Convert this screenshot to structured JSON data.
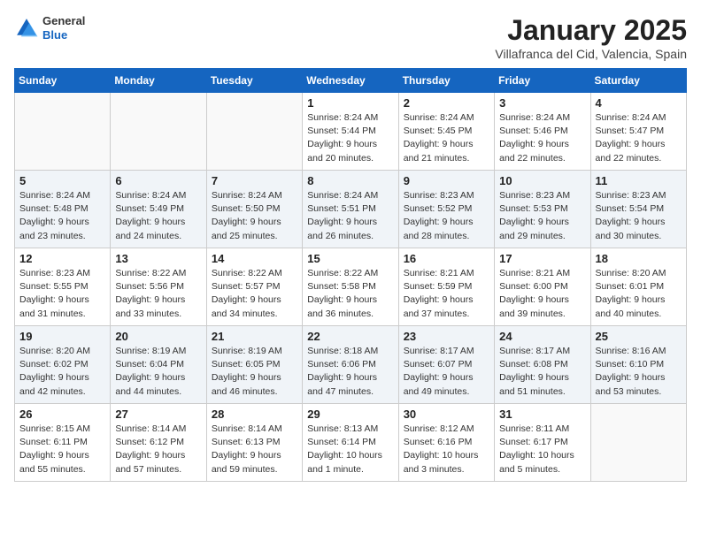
{
  "header": {
    "logo_general": "General",
    "logo_blue": "Blue",
    "month_title": "January 2025",
    "location": "Villafranca del Cid, Valencia, Spain"
  },
  "weekdays": [
    "Sunday",
    "Monday",
    "Tuesday",
    "Wednesday",
    "Thursday",
    "Friday",
    "Saturday"
  ],
  "weeks": [
    [
      {
        "day": "",
        "sunrise": "",
        "sunset": "",
        "daylight": ""
      },
      {
        "day": "",
        "sunrise": "",
        "sunset": "",
        "daylight": ""
      },
      {
        "day": "",
        "sunrise": "",
        "sunset": "",
        "daylight": ""
      },
      {
        "day": "1",
        "sunrise": "Sunrise: 8:24 AM",
        "sunset": "Sunset: 5:44 PM",
        "daylight": "Daylight: 9 hours and 20 minutes."
      },
      {
        "day": "2",
        "sunrise": "Sunrise: 8:24 AM",
        "sunset": "Sunset: 5:45 PM",
        "daylight": "Daylight: 9 hours and 21 minutes."
      },
      {
        "day": "3",
        "sunrise": "Sunrise: 8:24 AM",
        "sunset": "Sunset: 5:46 PM",
        "daylight": "Daylight: 9 hours and 22 minutes."
      },
      {
        "day": "4",
        "sunrise": "Sunrise: 8:24 AM",
        "sunset": "Sunset: 5:47 PM",
        "daylight": "Daylight: 9 hours and 22 minutes."
      }
    ],
    [
      {
        "day": "5",
        "sunrise": "Sunrise: 8:24 AM",
        "sunset": "Sunset: 5:48 PM",
        "daylight": "Daylight: 9 hours and 23 minutes."
      },
      {
        "day": "6",
        "sunrise": "Sunrise: 8:24 AM",
        "sunset": "Sunset: 5:49 PM",
        "daylight": "Daylight: 9 hours and 24 minutes."
      },
      {
        "day": "7",
        "sunrise": "Sunrise: 8:24 AM",
        "sunset": "Sunset: 5:50 PM",
        "daylight": "Daylight: 9 hours and 25 minutes."
      },
      {
        "day": "8",
        "sunrise": "Sunrise: 8:24 AM",
        "sunset": "Sunset: 5:51 PM",
        "daylight": "Daylight: 9 hours and 26 minutes."
      },
      {
        "day": "9",
        "sunrise": "Sunrise: 8:23 AM",
        "sunset": "Sunset: 5:52 PM",
        "daylight": "Daylight: 9 hours and 28 minutes."
      },
      {
        "day": "10",
        "sunrise": "Sunrise: 8:23 AM",
        "sunset": "Sunset: 5:53 PM",
        "daylight": "Daylight: 9 hours and 29 minutes."
      },
      {
        "day": "11",
        "sunrise": "Sunrise: 8:23 AM",
        "sunset": "Sunset: 5:54 PM",
        "daylight": "Daylight: 9 hours and 30 minutes."
      }
    ],
    [
      {
        "day": "12",
        "sunrise": "Sunrise: 8:23 AM",
        "sunset": "Sunset: 5:55 PM",
        "daylight": "Daylight: 9 hours and 31 minutes."
      },
      {
        "day": "13",
        "sunrise": "Sunrise: 8:22 AM",
        "sunset": "Sunset: 5:56 PM",
        "daylight": "Daylight: 9 hours and 33 minutes."
      },
      {
        "day": "14",
        "sunrise": "Sunrise: 8:22 AM",
        "sunset": "Sunset: 5:57 PM",
        "daylight": "Daylight: 9 hours and 34 minutes."
      },
      {
        "day": "15",
        "sunrise": "Sunrise: 8:22 AM",
        "sunset": "Sunset: 5:58 PM",
        "daylight": "Daylight: 9 hours and 36 minutes."
      },
      {
        "day": "16",
        "sunrise": "Sunrise: 8:21 AM",
        "sunset": "Sunset: 5:59 PM",
        "daylight": "Daylight: 9 hours and 37 minutes."
      },
      {
        "day": "17",
        "sunrise": "Sunrise: 8:21 AM",
        "sunset": "Sunset: 6:00 PM",
        "daylight": "Daylight: 9 hours and 39 minutes."
      },
      {
        "day": "18",
        "sunrise": "Sunrise: 8:20 AM",
        "sunset": "Sunset: 6:01 PM",
        "daylight": "Daylight: 9 hours and 40 minutes."
      }
    ],
    [
      {
        "day": "19",
        "sunrise": "Sunrise: 8:20 AM",
        "sunset": "Sunset: 6:02 PM",
        "daylight": "Daylight: 9 hours and 42 minutes."
      },
      {
        "day": "20",
        "sunrise": "Sunrise: 8:19 AM",
        "sunset": "Sunset: 6:04 PM",
        "daylight": "Daylight: 9 hours and 44 minutes."
      },
      {
        "day": "21",
        "sunrise": "Sunrise: 8:19 AM",
        "sunset": "Sunset: 6:05 PM",
        "daylight": "Daylight: 9 hours and 46 minutes."
      },
      {
        "day": "22",
        "sunrise": "Sunrise: 8:18 AM",
        "sunset": "Sunset: 6:06 PM",
        "daylight": "Daylight: 9 hours and 47 minutes."
      },
      {
        "day": "23",
        "sunrise": "Sunrise: 8:17 AM",
        "sunset": "Sunset: 6:07 PM",
        "daylight": "Daylight: 9 hours and 49 minutes."
      },
      {
        "day": "24",
        "sunrise": "Sunrise: 8:17 AM",
        "sunset": "Sunset: 6:08 PM",
        "daylight": "Daylight: 9 hours and 51 minutes."
      },
      {
        "day": "25",
        "sunrise": "Sunrise: 8:16 AM",
        "sunset": "Sunset: 6:10 PM",
        "daylight": "Daylight: 9 hours and 53 minutes."
      }
    ],
    [
      {
        "day": "26",
        "sunrise": "Sunrise: 8:15 AM",
        "sunset": "Sunset: 6:11 PM",
        "daylight": "Daylight: 9 hours and 55 minutes."
      },
      {
        "day": "27",
        "sunrise": "Sunrise: 8:14 AM",
        "sunset": "Sunset: 6:12 PM",
        "daylight": "Daylight: 9 hours and 57 minutes."
      },
      {
        "day": "28",
        "sunrise": "Sunrise: 8:14 AM",
        "sunset": "Sunset: 6:13 PM",
        "daylight": "Daylight: 9 hours and 59 minutes."
      },
      {
        "day": "29",
        "sunrise": "Sunrise: 8:13 AM",
        "sunset": "Sunset: 6:14 PM",
        "daylight": "Daylight: 10 hours and 1 minute."
      },
      {
        "day": "30",
        "sunrise": "Sunrise: 8:12 AM",
        "sunset": "Sunset: 6:16 PM",
        "daylight": "Daylight: 10 hours and 3 minutes."
      },
      {
        "day": "31",
        "sunrise": "Sunrise: 8:11 AM",
        "sunset": "Sunset: 6:17 PM",
        "daylight": "Daylight: 10 hours and 5 minutes."
      },
      {
        "day": "",
        "sunrise": "",
        "sunset": "",
        "daylight": ""
      }
    ]
  ]
}
